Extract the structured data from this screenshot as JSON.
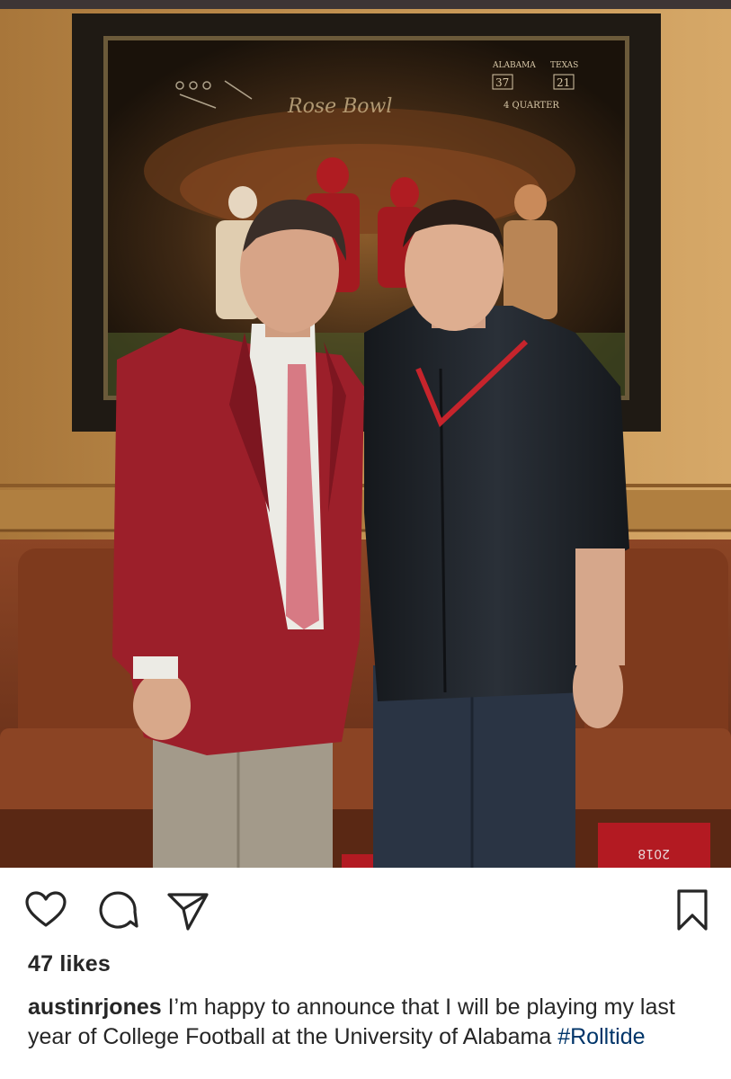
{
  "post": {
    "image": {
      "alt": "",
      "colors": {
        "wall": "#b98a45",
        "frame": "#1f1a14",
        "painting": "#3a2614",
        "couch": "#7a3a20",
        "jacket_red": "#9c1f2a",
        "jacket_dark": "#1d2126"
      },
      "painting_text": {
        "team1": "ALABAMA",
        "team2": "TEXAS",
        "score1": "37",
        "score2": "21",
        "quarter": "4 QUARTER",
        "bowl": "Rose Bowl"
      },
      "box_text": "2018"
    },
    "actions": {
      "like": "heart-icon",
      "comment": "comment-icon",
      "share": "paper-plane-icon",
      "save": "bookmark-icon"
    },
    "likes_text": "47 likes",
    "caption": {
      "username": "austinrjones",
      "text": "I’m happy to announce that I will be playing my last year of College Football at the University of Alabama",
      "hashtag": "#Rolltide"
    }
  }
}
